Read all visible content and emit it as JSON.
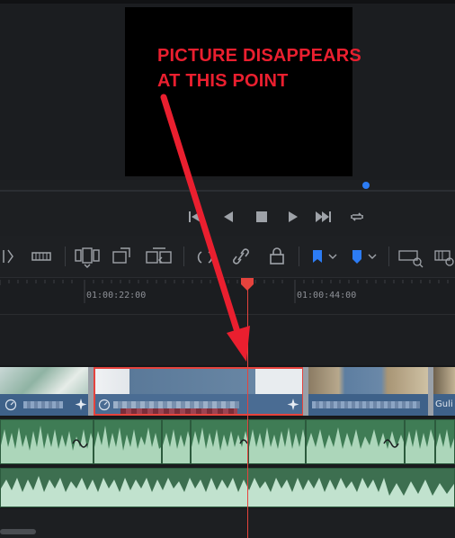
{
  "annotation": {
    "line1": "PICTURE DISAPPEARS",
    "line2": "AT THIS POINT",
    "color": "#ea1f2f"
  },
  "ruler": {
    "timecodes": [
      "01:00:22:00",
      "01:00:44:00"
    ]
  },
  "video_track": {
    "clips": [
      {
        "label": ""
      },
      {
        "label": ""
      },
      {
        "label": ""
      },
      {
        "label": "Guli"
      }
    ]
  },
  "toolbar": {
    "icons": [
      "trim-mode-icon",
      "razor-icon",
      "insert-clip-icon",
      "overwrite-clip-icon",
      "replace-clip-icon",
      "snapping-icon",
      "link-icon",
      "lock-icon",
      "flag-icon",
      "marker-icon",
      "zoom-full-icon",
      "zoom-detail-icon"
    ]
  },
  "transport": {
    "icons": [
      "go-to-start-icon",
      "play-reverse-icon",
      "stop-icon",
      "play-icon",
      "go-to-end-icon",
      "loop-icon"
    ]
  },
  "colors": {
    "accent_blue": "#2c7cf5",
    "playhead": "#e5433d",
    "video_clip": "#3e6189",
    "audio_clip": "#3f7c55"
  }
}
